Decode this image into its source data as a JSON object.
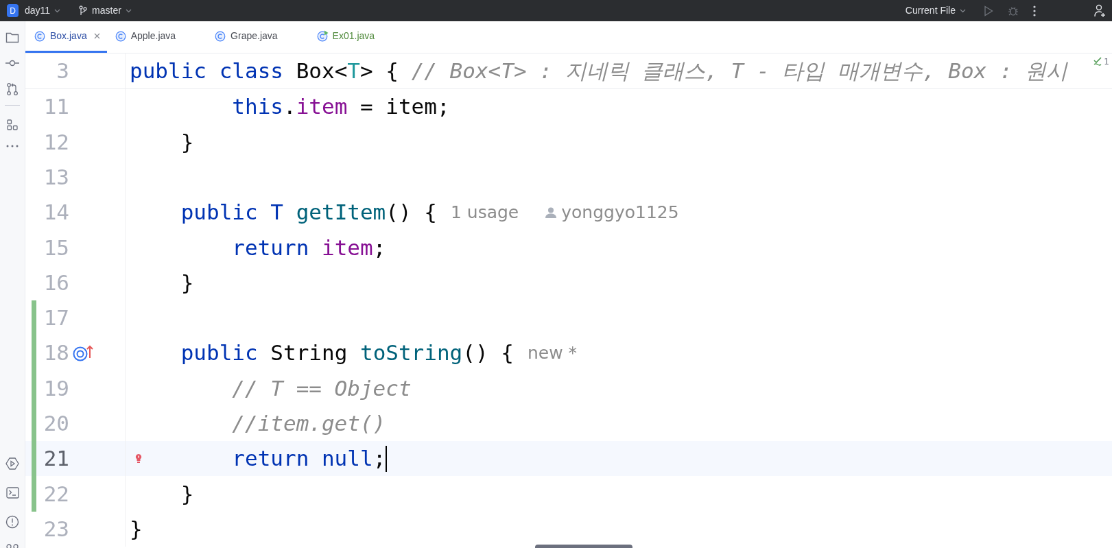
{
  "title_bar": {
    "project_badge": "D",
    "project": "day11",
    "branch": "master",
    "run_config": "Current File"
  },
  "tabs": [
    {
      "label": "Box.java",
      "selected": true,
      "kind": "class",
      "closable": true
    },
    {
      "label": "Apple.java",
      "selected": false,
      "kind": "class",
      "closable": false
    },
    {
      "label": "Grape.java",
      "selected": false,
      "kind": "class",
      "closable": false
    },
    {
      "label": "Ex01.java",
      "selected": false,
      "kind": "runnable",
      "closable": false
    }
  ],
  "sticky_line": {
    "number": "3",
    "tokens": [
      {
        "kind": "keyword",
        "text": "public class "
      },
      {
        "kind": "plain",
        "text": "Box<"
      },
      {
        "kind": "typeparam",
        "text": "T"
      },
      {
        "kind": "plain",
        "text": "> { "
      },
      {
        "kind": "comment",
        "text": "// Box<T> : 지네릭 클래스, T - 타입 매개변수, Box : 원시"
      }
    ],
    "inspection_count": "1"
  },
  "lines": [
    {
      "number": "11",
      "changed": false,
      "current": false,
      "tokens": [
        {
          "kind": "keyword",
          "text": "        this"
        },
        {
          "kind": "plain",
          "text": "."
        },
        {
          "kind": "field",
          "text": "item"
        },
        {
          "kind": "plain",
          "text": " = item;"
        }
      ]
    },
    {
      "number": "12",
      "changed": false,
      "current": false,
      "tokens": [
        {
          "kind": "plain",
          "text": "    }"
        }
      ]
    },
    {
      "number": "13",
      "changed": false,
      "current": false
    },
    {
      "number": "14",
      "changed": false,
      "current": false,
      "tokens": [
        {
          "kind": "keyword",
          "text": "    public T "
        },
        {
          "kind": "method",
          "text": "getItem"
        },
        {
          "kind": "plain",
          "text": "() {"
        }
      ],
      "hints": [
        {
          "kind": "usage",
          "text": "1 usage"
        },
        {
          "kind": "author",
          "text": "yonggyo1125"
        }
      ]
    },
    {
      "number": "15",
      "changed": false,
      "current": false,
      "tokens": [
        {
          "kind": "keyword",
          "text": "        return "
        },
        {
          "kind": "field",
          "text": "item"
        },
        {
          "kind": "plain",
          "text": ";"
        }
      ]
    },
    {
      "number": "16",
      "changed": false,
      "current": false,
      "tokens": [
        {
          "kind": "plain",
          "text": "    }"
        }
      ]
    },
    {
      "number": "17",
      "changed": true,
      "current": false
    },
    {
      "number": "18",
      "changed": true,
      "current": false,
      "overrides": true,
      "tokens": [
        {
          "kind": "keyword",
          "text": "    public "
        },
        {
          "kind": "plain",
          "text": "String "
        },
        {
          "kind": "method",
          "text": "toString"
        },
        {
          "kind": "plain",
          "text": "() {"
        }
      ],
      "hints": [
        {
          "kind": "usage",
          "text": "new *"
        }
      ]
    },
    {
      "number": "19",
      "changed": true,
      "current": false,
      "tokens": [
        {
          "kind": "comment",
          "text": "        // T == Object"
        }
      ]
    },
    {
      "number": "20",
      "changed": true,
      "current": false,
      "tokens": [
        {
          "kind": "comment",
          "text": "        //item.get()"
        }
      ]
    },
    {
      "number": "21",
      "changed": true,
      "current": true,
      "bulb": true,
      "caret": true,
      "tokens": [
        {
          "kind": "keyword",
          "text": "        return null"
        },
        {
          "kind": "plain",
          "text": ";"
        }
      ]
    },
    {
      "number": "22",
      "changed": true,
      "current": false,
      "tokens": [
        {
          "kind": "plain",
          "text": "    }"
        }
      ]
    },
    {
      "number": "23",
      "changed": false,
      "current": false,
      "tokens": [
        {
          "kind": "plain",
          "text": "}"
        }
      ]
    }
  ]
}
